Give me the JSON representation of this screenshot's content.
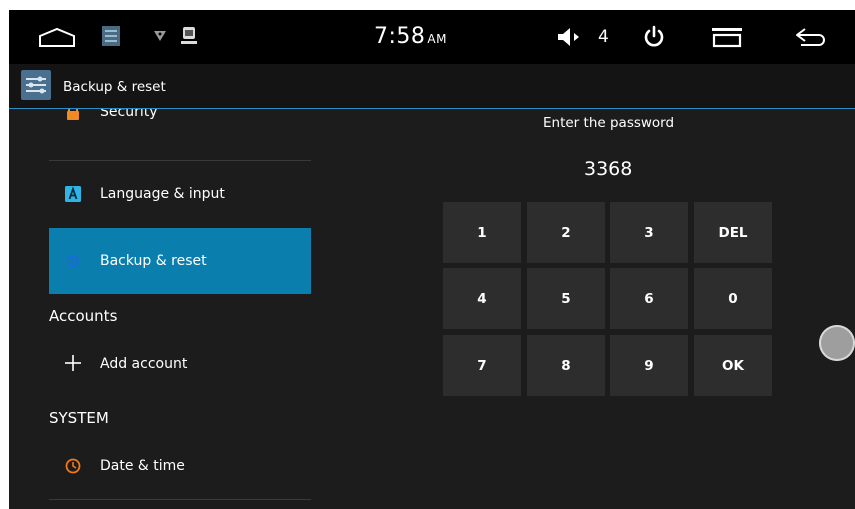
{
  "status_bar": {
    "time": "7:58",
    "ampm": "AM",
    "volume": "4"
  },
  "action_bar": {
    "title": "Backup & reset"
  },
  "settings_list": {
    "items": [
      {
        "label": "Security",
        "icon": "lock-icon",
        "color": "#f08a24"
      },
      {
        "label": "Language & input",
        "icon": "keyboard-a-icon",
        "color": "#2fb4e8"
      },
      {
        "label": "Backup & reset",
        "icon": "restore-icon",
        "color": "#1a6bd8",
        "selected": true
      }
    ],
    "accounts_header": "Accounts",
    "add_account": "Add account",
    "system_header": "SYSTEM",
    "date_time": "Date & time"
  },
  "password_panel": {
    "prompt": "Enter the password",
    "value": "3368",
    "keys": [
      "1",
      "2",
      "3",
      "DEL",
      "4",
      "5",
      "6",
      "0",
      "7",
      "8",
      "9",
      "OK"
    ]
  },
  "colors": {
    "accent": "#0a7fae",
    "divider": "#2a8ec4",
    "background": "#1c1c1c"
  }
}
